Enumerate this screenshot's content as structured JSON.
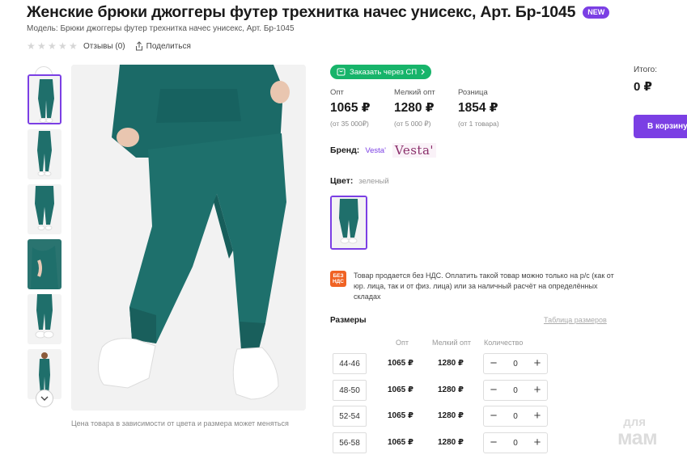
{
  "product": {
    "title": "Женские брюки джоггеры футер трехнитка начес унисекс, Арт. Бр-1045",
    "badge": "NEW",
    "model": "Модель: Брюки джоггеры футер трехнитка начес унисекс, Арт. Бр-1045"
  },
  "meta": {
    "reviews": "Отзывы (0)",
    "share": "Поделиться",
    "star_icon": "star-icon",
    "share_icon": "share-icon"
  },
  "gallery": {
    "photo_note": "Цена товара в зависимости от цвета и размера может меняться",
    "thumbnail_count": 6
  },
  "order": {
    "button_label": "Заказать через СП",
    "button_color": "#17b46a"
  },
  "prices": [
    {
      "label": "Опт",
      "value": "1065 ₽",
      "note": "(от 35 000₽)"
    },
    {
      "label": "Мелкий опт",
      "value": "1280 ₽",
      "note": "(от 5 000 ₽)"
    },
    {
      "label": "Розница",
      "value": "1854 ₽",
      "note": "(от 1 товара)"
    }
  ],
  "summary": {
    "total_label": "Итого:",
    "total_value": "0 ₽",
    "cart_button": "В корзину",
    "accent": "#7b3fe4"
  },
  "brand": {
    "label": "Бренд:",
    "link": "Vesta'",
    "logo_text": "Vesta'"
  },
  "color": {
    "label": "Цвет:",
    "value": "зеленый",
    "swatch_color": "#1f6f6b"
  },
  "vat": {
    "icon_line1": "БЕЗ",
    "icon_line2": "НДС",
    "text": "Товар продается без НДС. Оплатить такой товар можно только на р/с (как от юр. лица, так и от физ. лица) или за наличный расчёт на определённых складах"
  },
  "sizes": {
    "title": "Размеры",
    "table_link": "Таблица размеров",
    "headers": {
      "opt": "Опт",
      "small_opt": "Мелкий опт",
      "quantity": "Количество"
    },
    "rows": [
      {
        "size": "44-46",
        "opt": "1065 ₽",
        "small_opt": "1280 ₽",
        "qty": "0"
      },
      {
        "size": "48-50",
        "opt": "1065 ₽",
        "small_opt": "1280 ₽",
        "qty": "0"
      },
      {
        "size": "52-54",
        "opt": "1065 ₽",
        "small_opt": "1280 ₽",
        "qty": "0"
      },
      {
        "size": "56-58",
        "opt": "1065 ₽",
        "small_opt": "1280 ₽",
        "qty": "0"
      }
    ],
    "minus": "−",
    "plus": "+"
  },
  "watermark": {
    "line1": "для",
    "line2": "мам"
  }
}
